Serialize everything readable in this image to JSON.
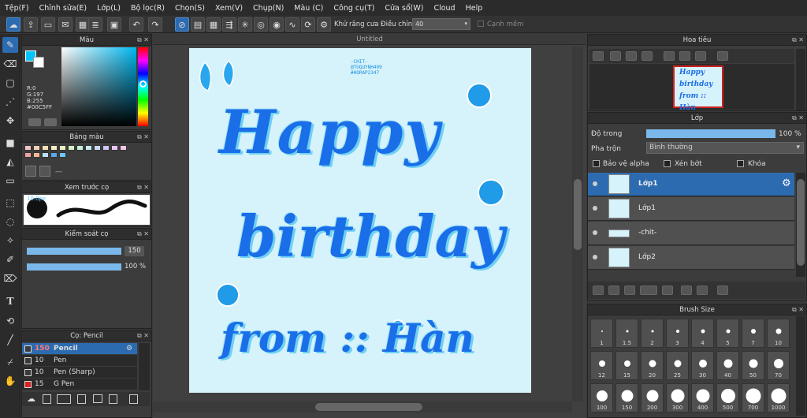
{
  "menu": [
    "Tệp(F)",
    "Chỉnh sửa(E)",
    "Lớp(L)",
    "Bộ lọc(R)",
    "Chọn(S)",
    "Xem(V)",
    "Chụp(N)",
    "Màu (C)",
    "Công cụ(T)",
    "Cửa sổ(W)",
    "Cloud",
    "Help"
  ],
  "toolbar": {
    "antialias_label": "Khử răng cưa",
    "adjust_label": "Điều chỉnh",
    "adjust_value": "40",
    "edge_label": "Cạnh mềm"
  },
  "color_panel": {
    "title": "Màu",
    "r": "R:0",
    "g": "G:197",
    "b": "B:255",
    "hex": "#00C5FF",
    "current_color": "#00c5ff"
  },
  "palette_panel": {
    "title": "Bảng màu",
    "placeholder": "---",
    "swatches": [
      "#f5c6c6",
      "#f7d0b5",
      "#f7e0b5",
      "#f5ecc4",
      "#e8f2c4",
      "#d3f2c6",
      "#c6f0dc",
      "#c6ecf0",
      "#c6dcf5",
      "#d0c6f5",
      "#e6c6f5",
      "#f5c6e6",
      "#f0a0a0",
      "#f5b890",
      "#bce0f5",
      "#5aa8e8",
      "#6ec6ff"
    ]
  },
  "brush_preview": {
    "title": "Xem trước cọ",
    "size_label": "10.0px"
  },
  "brush_control": {
    "title": "Kiểm soát cọ",
    "size_value": "150",
    "opacity_value": "100 %"
  },
  "brush_list": {
    "title": "Cọ: Pencil",
    "items": [
      {
        "size": "150",
        "name": "Pencil",
        "color": "#3a3a3a",
        "selected": true
      },
      {
        "size": "10",
        "name": "Pen",
        "color": "#3a3a3a",
        "selected": false
      },
      {
        "size": "10",
        "name": "Pen (Sharp)",
        "color": "#3a3a3a",
        "selected": false
      },
      {
        "size": "15",
        "name": "G Pen",
        "color": "#e02020",
        "selected": false
      }
    ]
  },
  "canvas": {
    "title": "Untitled",
    "credit_lines": [
      "-CHIT-",
      "@TUQUYNH409",
      "#HORAP2347"
    ],
    "text_lines": [
      "Happy",
      "birthday",
      "from :: Hàn"
    ]
  },
  "navigator": {
    "title": "Hoa tiêu"
  },
  "layer_panel": {
    "title": "Lớp",
    "opacity_label": "Độ trong",
    "opacity_value": "100 %",
    "opacity_fraction": 1.0,
    "blend_label": "Pha trộn",
    "blend_value": "Bình thường",
    "protect_alpha": "Bảo vệ alpha",
    "clipping": "Xén bớt",
    "lock": "Khóa",
    "layers": [
      {
        "name": "Lớp1",
        "selected": true
      },
      {
        "name": "Lớp1",
        "selected": false
      },
      {
        "name": "-chit-",
        "selected": false
      },
      {
        "name": "Lớp2",
        "selected": false
      }
    ]
  },
  "brush_size": {
    "title": "Brush Size",
    "sizes": [
      "1",
      "1.5",
      "2",
      "3",
      "4",
      "5",
      "7",
      "10",
      "12",
      "15",
      "20",
      "25",
      "30",
      "40",
      "50",
      "70",
      "100",
      "150",
      "200",
      "300",
      "400",
      "500",
      "700",
      "1000"
    ]
  }
}
